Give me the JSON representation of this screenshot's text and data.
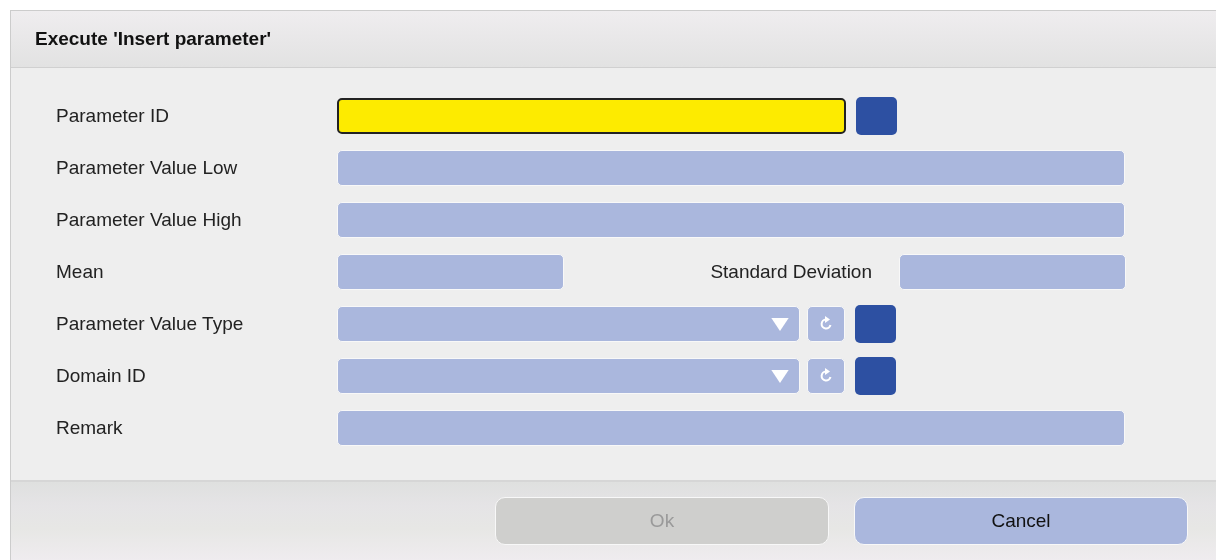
{
  "dialog": {
    "title": "Execute 'Insert parameter'"
  },
  "fields": [
    {
      "kind": "lookup",
      "label": "Parameter ID",
      "highlighted": true
    },
    {
      "kind": "text",
      "label": "Parameter Value Low",
      "highlighted": false
    },
    {
      "kind": "text",
      "label": "Parameter Value High",
      "highlighted": false
    },
    {
      "kind": "pair",
      "label": "Mean",
      "second_label": "Standard Deviation",
      "highlighted": false
    },
    {
      "kind": "dropdown",
      "label": "Parameter Value Type",
      "highlighted": false
    },
    {
      "kind": "dropdown",
      "label": "Domain ID",
      "highlighted": false
    },
    {
      "kind": "text",
      "label": "Remark",
      "highlighted": false
    }
  ],
  "buttons": [
    {
      "label": "Ok",
      "disabled": true
    },
    {
      "label": "Cancel",
      "disabled": false
    }
  ]
}
